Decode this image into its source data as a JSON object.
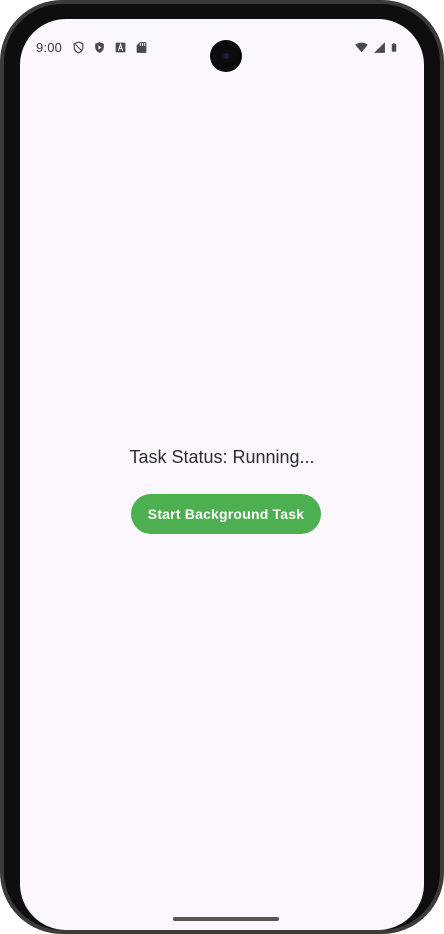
{
  "status_bar": {
    "time": "9:00",
    "left_icons": [
      "shield-icon",
      "play-protect-icon",
      "a-icon",
      "sd-card-icon"
    ],
    "right_icons": [
      "wifi-icon",
      "cell-signal-icon",
      "battery-icon"
    ]
  },
  "main": {
    "status_text": "Task Status: Running...",
    "start_button_label": "Start Background Task"
  },
  "colors": {
    "background": "#fcf7fe",
    "button": "#4caf50",
    "button_text": "#ffffff"
  }
}
